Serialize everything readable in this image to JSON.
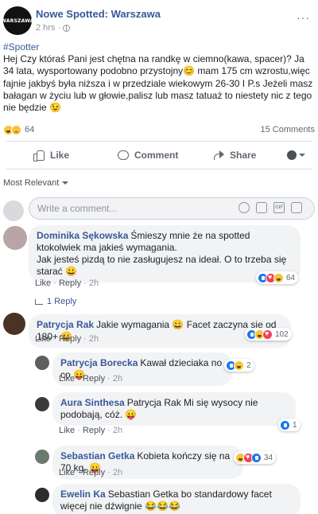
{
  "post": {
    "page_name": "Nowe Spotted: Warszawa",
    "logo_text": "WARSZAWA",
    "time": "2 hrs ·",
    "hashtag": "#Spotter",
    "text": "Hej Czy któraś Pani jest chętna na randkę w ciemno(kawa, spacer)? Ja 34 lata, wysportowany podobno przystojny😊 mam 175 cm wzrostu,więc fajnie jakbyś była niższa i w przedziale wiekowym 26-30 I P.s Jeżeli masz bałagan w życiu lub w głowie,palisz lub masz tatuaż to niestety nic z tego nie będzie 😉",
    "reaction_count": "64",
    "comments_count": "15 Comments"
  },
  "actions": {
    "like": "Like",
    "comment": "Comment",
    "share": "Share"
  },
  "sort_label": "Most Relevant",
  "comment_input": {
    "placeholder": "Write a comment..."
  },
  "comments": [
    {
      "author": "Dominika Sękowska",
      "text": "Śmieszy mnie że na spotted ktokolwiek ma jakieś wymagania.\nJak jesteś pizdą to nie zasługujesz na ideał. O to trzeba się starać 😀",
      "like": "Like",
      "reply": "Reply",
      "time": "2h",
      "reactions": "64",
      "replies_link": "1 Reply"
    },
    {
      "author": "Patrycja Rak",
      "text": "Jakie wymagania 😀 Facet zaczyna się od 180+ 😀",
      "like": "Like",
      "reply": "Reply",
      "time": "2h",
      "reactions": "102"
    }
  ],
  "replies": [
    {
      "author": "Patrycja Borecka",
      "text": "Kawał dzieciaka no co 😛",
      "like": "Like",
      "reply": "Reply",
      "time": "2h",
      "reactions": "2"
    },
    {
      "author": "Aura Sinthesa",
      "text": "Patrycja Rak Mi się wysocy nie podobają, cóż. 😛",
      "like": "Like",
      "reply": "Reply",
      "time": "2h",
      "reactions": "1"
    },
    {
      "author": "Sebastian Getka",
      "text": "Kobieta kończy się na 70 kg. 😛",
      "like": "Like",
      "reply": "Reply",
      "time": "2h",
      "reactions": "34"
    },
    {
      "author": "Ewelin Ka",
      "text": "Sebastian Getka bo standardowy facet więcej nie dźwignie 😂😂😂"
    }
  ],
  "colors": {
    "link_blue": "#385898",
    "bubble_bg": "#f2f3f5",
    "meta_gray": "#90949c"
  }
}
